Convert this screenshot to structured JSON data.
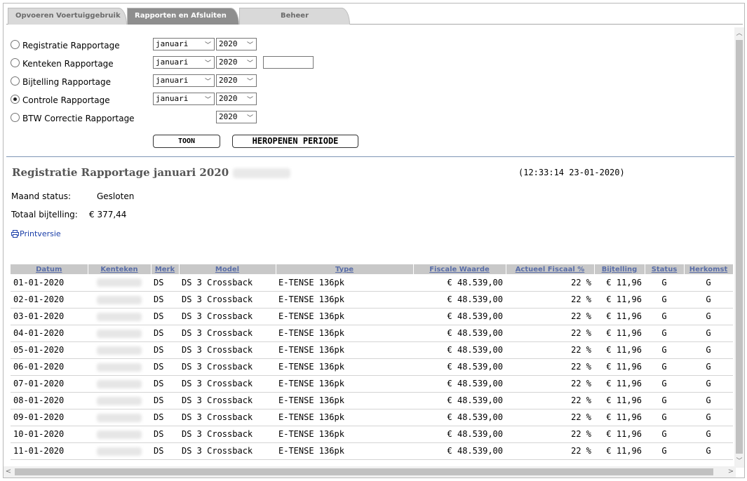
{
  "tabs": [
    "Opvoeren Voertuiggebruik",
    "Rapporten en Afsluiten",
    "Beheer"
  ],
  "form": {
    "rows": [
      {
        "label": "Registratie Rapportage",
        "month": "januari",
        "year": "2020",
        "checked": false
      },
      {
        "label": "Kenteken Rapportage",
        "month": "januari",
        "year": "2020",
        "checked": false
      },
      {
        "label": "Bijtelling Rapportage",
        "month": "januari",
        "year": "2020",
        "checked": false
      },
      {
        "label": "Controle Rapportage",
        "month": "januari",
        "year": "2020",
        "checked": true
      },
      {
        "label": "BTW Correctie Rapportage",
        "month": "",
        "year": "2020",
        "checked": false
      }
    ],
    "toon_label": "TOON",
    "reopen_label": "HEROPENEN PERIODE"
  },
  "report": {
    "title": "Registratie Rapportage januari 2020",
    "timestamp": "(12:33:14 23-01-2020)",
    "status_label": "Maand status:",
    "status_value": "Gesloten",
    "total_label": "Totaal bijtelling:",
    "total_value": "€ 377,44",
    "print_label": "Printversie"
  },
  "table": {
    "headers": [
      "Datum",
      "Kenteken",
      "Merk",
      "Model",
      "Type",
      "Fiscale Waarde",
      "Actueel Fiscaal %",
      "Bijtelling",
      "Status",
      "Herkomst"
    ],
    "rows": [
      [
        "01-01-2020",
        "",
        "DS",
        "DS 3 Crossback",
        "E-TENSE 136pk",
        "€ 48.539,00",
        "22 %",
        "€ 11,96",
        "G",
        "G"
      ],
      [
        "02-01-2020",
        "",
        "DS",
        "DS 3 Crossback",
        "E-TENSE 136pk",
        "€ 48.539,00",
        "22 %",
        "€ 11,96",
        "G",
        "G"
      ],
      [
        "03-01-2020",
        "",
        "DS",
        "DS 3 Crossback",
        "E-TENSE 136pk",
        "€ 48.539,00",
        "22 %",
        "€ 11,96",
        "G",
        "G"
      ],
      [
        "04-01-2020",
        "",
        "DS",
        "DS 3 Crossback",
        "E-TENSE 136pk",
        "€ 48.539,00",
        "22 %",
        "€ 11,96",
        "G",
        "G"
      ],
      [
        "05-01-2020",
        "",
        "DS",
        "DS 3 Crossback",
        "E-TENSE 136pk",
        "€ 48.539,00",
        "22 %",
        "€ 11,96",
        "G",
        "G"
      ],
      [
        "06-01-2020",
        "",
        "DS",
        "DS 3 Crossback",
        "E-TENSE 136pk",
        "€ 48.539,00",
        "22 %",
        "€ 11,96",
        "G",
        "G"
      ],
      [
        "07-01-2020",
        "",
        "DS",
        "DS 3 Crossback",
        "E-TENSE 136pk",
        "€ 48.539,00",
        "22 %",
        "€ 11,96",
        "G",
        "G"
      ],
      [
        "08-01-2020",
        "",
        "DS",
        "DS 3 Crossback",
        "E-TENSE 136pk",
        "€ 48.539,00",
        "22 %",
        "€ 11,96",
        "G",
        "G"
      ],
      [
        "09-01-2020",
        "",
        "DS",
        "DS 3 Crossback",
        "E-TENSE 136pk",
        "€ 48.539,00",
        "22 %",
        "€ 11,96",
        "G",
        "G"
      ],
      [
        "10-01-2020",
        "",
        "DS",
        "DS 3 Crossback",
        "E-TENSE 136pk",
        "€ 48.539,00",
        "22 %",
        "€ 11,96",
        "G",
        "G"
      ],
      [
        "11-01-2020",
        "",
        "DS",
        "DS 3 Crossback",
        "E-TENSE 136pk",
        "€ 48.539,00",
        "22 %",
        "€ 11,96",
        "G",
        "G"
      ]
    ]
  },
  "icons": {
    "printer": "printer-icon",
    "chevron": "chevron-down-icon"
  },
  "colors": {
    "active_tab": "#8e8e8e",
    "header_link": "#5a6ea8",
    "separator": "#7d95b5",
    "title": "#555555"
  }
}
